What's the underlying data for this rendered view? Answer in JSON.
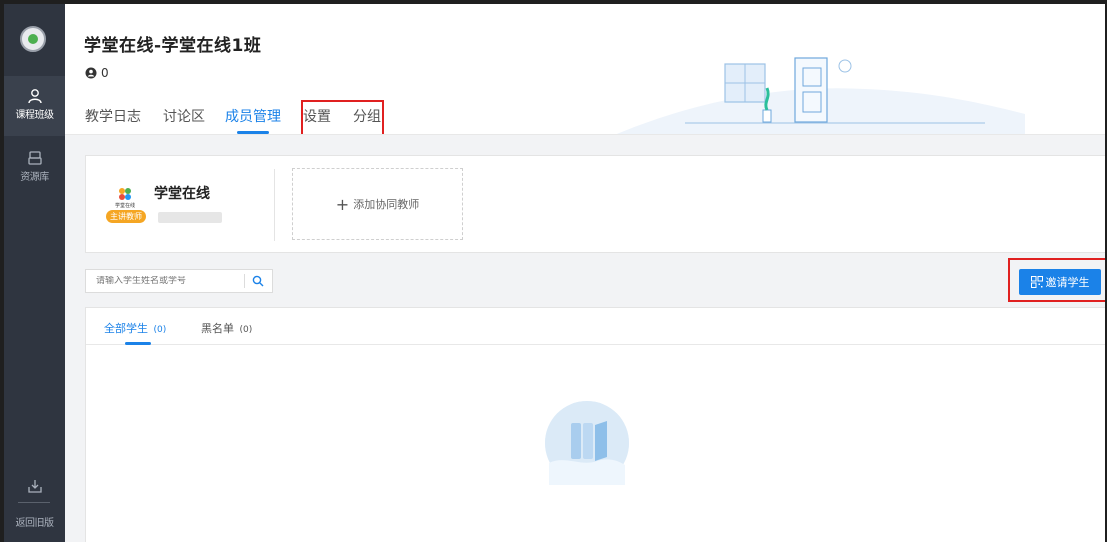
{
  "sidebar": {
    "items": [
      {
        "label": "课程班级",
        "icon": "class-icon",
        "active": true
      },
      {
        "label": "资源库",
        "icon": "resource-icon",
        "active": false
      }
    ],
    "download_icon": "download-icon",
    "back_label": "返回旧版"
  },
  "header": {
    "title": "学堂在线-学堂在线1班",
    "member_count": "0",
    "tabs": [
      {
        "label": "教学日志"
      },
      {
        "label": "讨论区"
      },
      {
        "label": "成员管理"
      },
      {
        "label": "设置"
      },
      {
        "label": "分组"
      }
    ],
    "active_tab": "成员管理"
  },
  "teacher": {
    "name": "学堂在线",
    "logo_text": "学堂在线",
    "badge": "主讲教师",
    "add_label": "添加协同教师"
  },
  "search": {
    "placeholder": "请输入学生姓名或学号"
  },
  "invite_button": {
    "label": "邀请学生"
  },
  "student_tabs": [
    {
      "label": "全部学生",
      "count": "(0)"
    },
    {
      "label": "黑名单",
      "count": "(0)"
    }
  ],
  "colors": {
    "accent": "#1b82e8",
    "sidebar_bg": "#2f3540",
    "highlight": "#e02020",
    "badge": "#f5a623"
  }
}
